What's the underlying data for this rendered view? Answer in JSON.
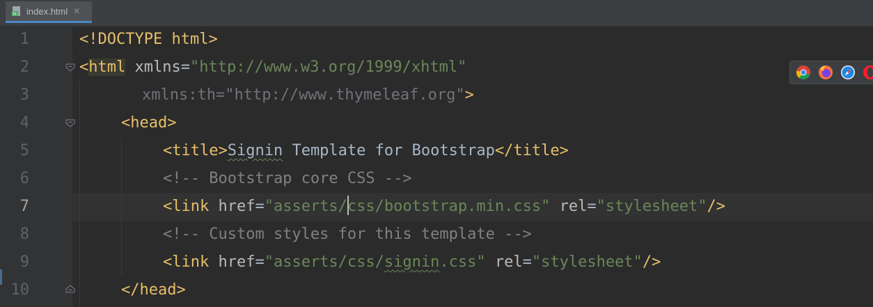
{
  "tab": {
    "filename": "index.html",
    "close_glyph": "✕",
    "file_icon": "html-file-icon"
  },
  "editor": {
    "current_line": 7,
    "lines": [
      {
        "num": "1"
      },
      {
        "num": "2"
      },
      {
        "num": "3"
      },
      {
        "num": "4"
      },
      {
        "num": "5"
      },
      {
        "num": "6"
      },
      {
        "num": "7"
      },
      {
        "num": "8"
      },
      {
        "num": "9"
      },
      {
        "num": "10"
      }
    ],
    "code": {
      "l1": {
        "open": "<!DOCTYPE",
        "rest": " html>"
      },
      "l2": {
        "lt": "<",
        "name": "html",
        "sp": " ",
        "attr": "xmlns",
        "eq": "=",
        "val": "\"http://www.w3.org/1999/xhtml\""
      },
      "l3": {
        "attr": "xmlns:th",
        "eq": "=",
        "val": "\"http://www.thymeleaf.org\"",
        "close": ">"
      },
      "l4": {
        "tag": "<head>"
      },
      "l5": {
        "open": "<title>",
        "word1": "Signin",
        "text": " Template for Bootstrap",
        "close": "</title>"
      },
      "l6": {
        "comment": "<!-- Bootstrap core CSS -->"
      },
      "l7": {
        "open": "<link",
        "attr1": " href",
        "eq1": "=",
        "val1a": "\"asserts/",
        "val1b": "css/bootstrap.min.css\"",
        "attr2": " rel",
        "eq2": "=",
        "val2": "\"stylesheet\"",
        "close": "/>"
      },
      "l8": {
        "comment": "<!-- Custom styles for this template -->"
      },
      "l9": {
        "open": "<link",
        "attr1": " href",
        "eq1": "=",
        "val1a": "\"asserts/css/",
        "val1typo": "signin",
        "val1b": ".css\"",
        "attr2": " rel",
        "eq2": "=",
        "val2": "\"stylesheet\"",
        "close": "/>"
      },
      "l10": {
        "tag": "</head>"
      }
    }
  },
  "browsers": [
    {
      "name": "chrome-icon",
      "color": "#4caf50"
    },
    {
      "name": "firefox-icon",
      "color": "#ff7139"
    },
    {
      "name": "safari-icon",
      "color": "#1e88e5"
    },
    {
      "name": "opera-icon",
      "color": "#ff1b2d"
    }
  ]
}
